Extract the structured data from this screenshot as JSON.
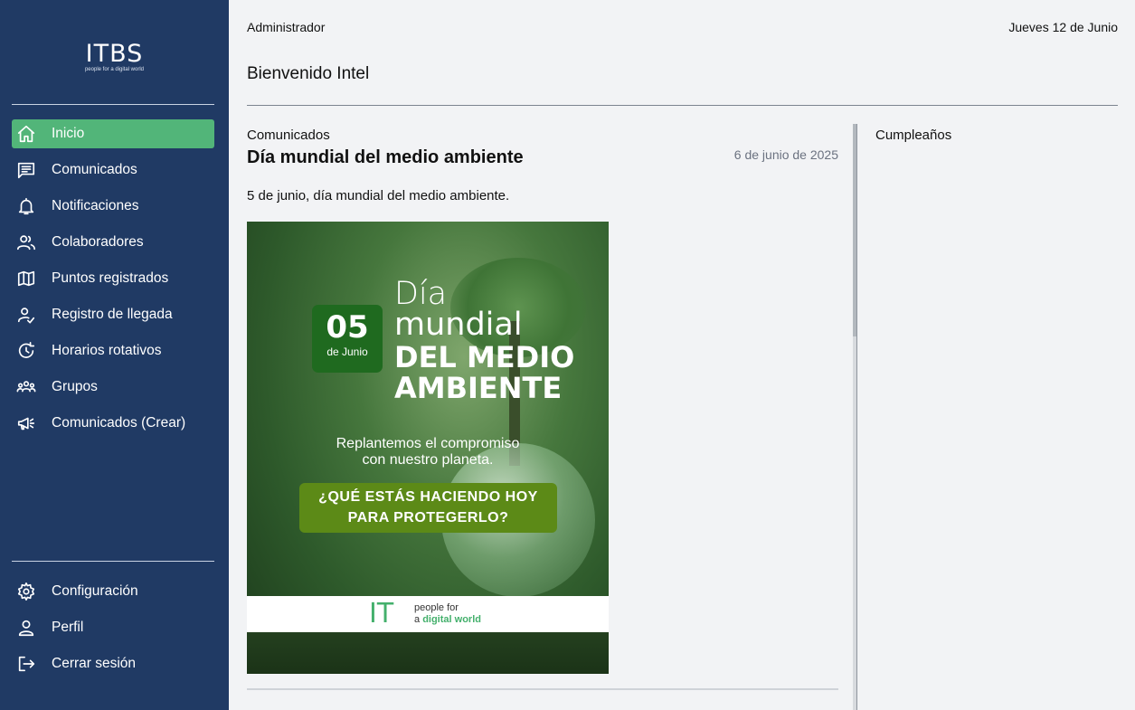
{
  "sidebar": {
    "logo": {
      "main": "ITBS",
      "tagline": "people for a digital world"
    },
    "nav_items": [
      {
        "label": "Inicio",
        "icon": "home-icon",
        "active": true
      },
      {
        "label": "Comunicados",
        "icon": "message-icon",
        "active": false
      },
      {
        "label": "Notificaciones",
        "icon": "bell-icon",
        "active": false
      },
      {
        "label": "Colaboradores",
        "icon": "users-icon",
        "active": false
      },
      {
        "label": "Puntos registrados",
        "icon": "map-icon",
        "active": false
      },
      {
        "label": "Registro de llegada",
        "icon": "user-check-icon",
        "active": false
      },
      {
        "label": "Horarios rotativos",
        "icon": "rotate-clock-icon",
        "active": false
      },
      {
        "label": "Grupos",
        "icon": "group-icon",
        "active": false
      },
      {
        "label": "Comunicados (Crear)",
        "icon": "megaphone-icon",
        "active": false
      }
    ],
    "bottom_items": [
      {
        "label": "Configuración",
        "icon": "gear-icon"
      },
      {
        "label": "Perfil",
        "icon": "user-icon"
      },
      {
        "label": "Cerrar sesión",
        "icon": "logout-icon"
      }
    ],
    "colors": {
      "background": "#203a64",
      "active": "#52b579"
    }
  },
  "header": {
    "user_role": "Administrador",
    "date": "Jueves 12 de Junio",
    "welcome": "Bienvenido Intel"
  },
  "feed": {
    "section_title": "Comunicados",
    "post": {
      "title": "Día mundial del medio ambiente",
      "date": "6 de junio de 2025",
      "body": "5 de junio, día mundial del medio ambiente.",
      "image": {
        "badge_day": "05",
        "badge_month": "de Junio",
        "line1": "Día",
        "line2": "mundial",
        "line3": "DEL MEDIO",
        "line4": "AMBIENTE",
        "subtitle_1": "Replantemos el compromiso",
        "subtitle_2": "con nuestro planeta.",
        "cta_1": "¿QUÉ ESTÁS HACIENDO HOY",
        "cta_2": "PARA PROTEGERLO?",
        "footer_logo": "IT",
        "footer_text_1": "people for",
        "footer_text_2a": "a ",
        "footer_text_2b": "digital world"
      }
    }
  },
  "birthdays": {
    "title": "Cumpleaños"
  }
}
